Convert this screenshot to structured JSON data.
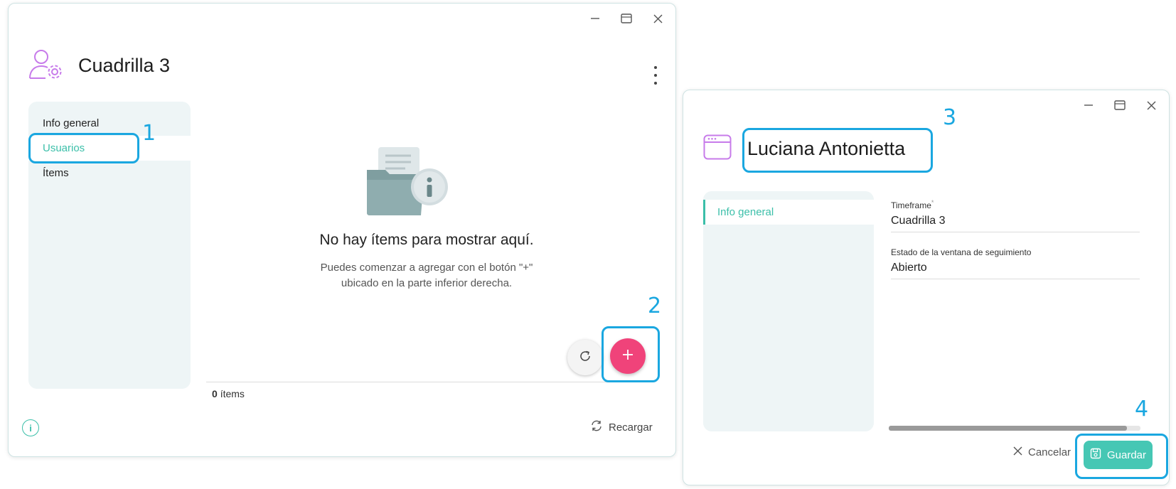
{
  "left_window": {
    "title": "Cuadrilla 3",
    "icon": "user-gear-icon",
    "window_controls": [
      "minimize-icon",
      "maximize-icon",
      "close-icon"
    ],
    "nav": [
      {
        "label": "Info general",
        "active": false
      },
      {
        "label": "Usuarios",
        "active": true
      },
      {
        "label": "Ítems",
        "active": false
      }
    ],
    "empty_state": {
      "title": "No hay ítems para mostrar aquí.",
      "description_line1": "Puedes comenzar a agregar con el botón \"+\"",
      "description_line2": "ubicado en la parte inferior derecha."
    },
    "items_count": "0",
    "items_label": "ítems",
    "reload_label": "Recargar",
    "info_icon": "info-icon"
  },
  "right_window": {
    "title": "Luciana Antonietta",
    "icon": "window-icon",
    "nav": [
      {
        "label": "Info general",
        "active": true
      }
    ],
    "fields": [
      {
        "label": "Timeframe",
        "required": "*",
        "value": "Cuadrilla 3"
      },
      {
        "label": "Estado de la ventana de seguimiento",
        "value": "Abierto"
      }
    ],
    "cancel_label": "Cancelar",
    "save_label": "Guardar"
  },
  "annotations": [
    "1",
    "2",
    "3",
    "4"
  ],
  "colors": {
    "accent": "#46c7b4",
    "fab": "#f0437a",
    "annotation": "#1aa7e0",
    "sidebar_bg": "#eef5f6",
    "icon_purple": "#c77bea"
  }
}
